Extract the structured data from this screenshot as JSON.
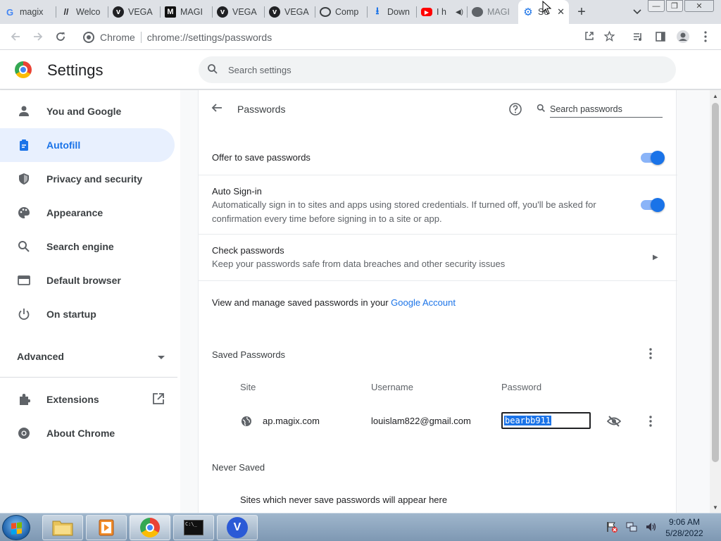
{
  "tabs": [
    {
      "title": "magix",
      "favicon": "google-g-icon"
    },
    {
      "title": "Welco",
      "favicon": "w-logo-icon"
    },
    {
      "title": "VEGA",
      "favicon": "vegas-v-icon"
    },
    {
      "title": "MAGI",
      "favicon": "magix-m-icon"
    },
    {
      "title": "VEGA",
      "favicon": "vegas-v-icon"
    },
    {
      "title": "VEGA",
      "favicon": "vegas-v-icon"
    },
    {
      "title": "Comp",
      "favicon": "compare-icon"
    },
    {
      "title": "Down",
      "favicon": "download-icon"
    },
    {
      "title": "I h",
      "favicon": "youtube-icon"
    },
    {
      "title": "MAGI",
      "favicon": "globe-icon"
    },
    {
      "title": "Se",
      "favicon": "settings-gear-icon",
      "active": true
    }
  ],
  "omnibox": {
    "site_label": "Chrome",
    "url": "chrome://settings/passwords"
  },
  "header": {
    "title": "Settings",
    "search_placeholder": "Search settings"
  },
  "nav": {
    "items": [
      {
        "label": "You and Google",
        "icon": "person-icon"
      },
      {
        "label": "Autofill",
        "icon": "clipboard-icon",
        "active": true
      },
      {
        "label": "Privacy and security",
        "icon": "shield-icon"
      },
      {
        "label": "Appearance",
        "icon": "palette-icon"
      },
      {
        "label": "Search engine",
        "icon": "search-icon"
      },
      {
        "label": "Default browser",
        "icon": "browser-icon"
      },
      {
        "label": "On startup",
        "icon": "power-icon"
      }
    ],
    "advanced_label": "Advanced",
    "extensions_label": "Extensions",
    "about_label": "About Chrome"
  },
  "passwords": {
    "title": "Passwords",
    "search_placeholder": "Search passwords",
    "offer_to_save": {
      "title": "Offer to save passwords",
      "enabled": true
    },
    "auto_signin": {
      "title": "Auto Sign-in",
      "description_line1": "Automatically sign in to sites and apps using stored credentials. If turned off, you'll be asked for",
      "description_line2": "confirmation every time before signing in to a site or app.",
      "enabled": true
    },
    "check": {
      "title": "Check passwords",
      "description": "Keep your passwords safe from data breaches and other security issues"
    },
    "google_account_prefix": "View and manage saved passwords in your ",
    "google_account_link": "Google Account",
    "saved_title": "Saved Passwords",
    "columns": {
      "site": "Site",
      "username": "Username",
      "password": "Password"
    },
    "entries": [
      {
        "site": "ap.magix.com",
        "username": "louislam822@gmail.com",
        "password": "bearbb911"
      }
    ],
    "never_saved_title": "Never Saved",
    "never_saved_empty": "Sites which never save passwords will appear here"
  },
  "taskbar": {
    "time": "9:06 AM",
    "date": "5/28/2022"
  },
  "colors": {
    "accent": "#1a73e8",
    "nav_active_bg": "#e8f0fe"
  }
}
